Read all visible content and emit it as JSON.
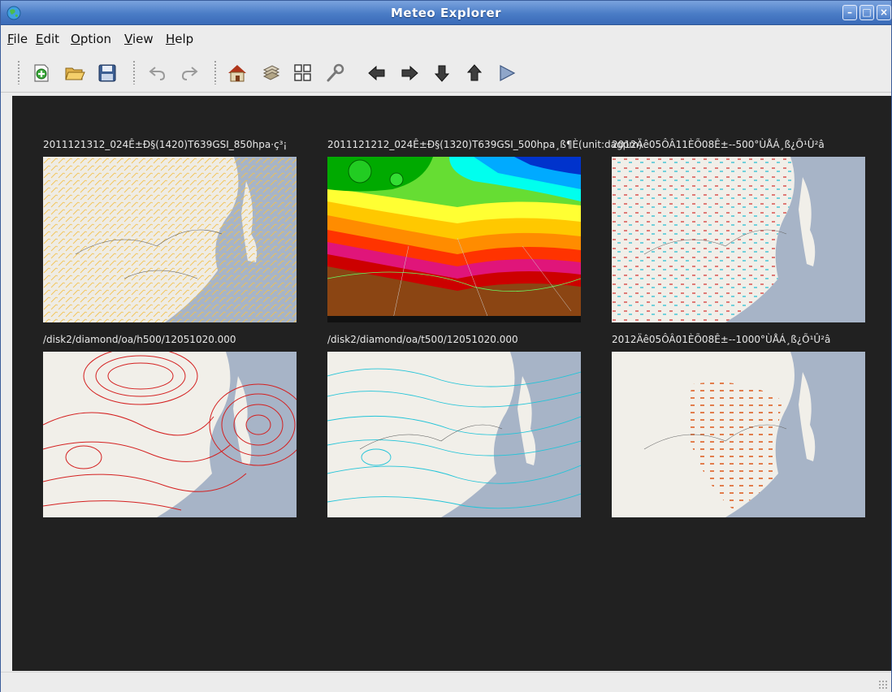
{
  "window": {
    "title": "Meteo Explorer"
  },
  "menu": [
    {
      "prefix": "",
      "mnemonic": "F",
      "rest": "ile"
    },
    {
      "prefix": "",
      "mnemonic": "E",
      "rest": "dit"
    },
    {
      "prefix": "",
      "mnemonic": "O",
      "rest": "ption"
    },
    {
      "prefix": "",
      "mnemonic": "V",
      "rest": "iew"
    },
    {
      "prefix": "",
      "mnemonic": "H",
      "rest": "elp"
    }
  ],
  "toolbar_icons": [
    "new-icon",
    "open-folder-icon",
    "save-icon",
    "undo-icon",
    "redo-icon",
    "home-icon",
    "layers-icon",
    "grid-icon",
    "wrench-icon",
    "arrow-left-icon",
    "arrow-right-icon",
    "arrow-down-icon",
    "arrow-up-icon",
    "play-icon"
  ],
  "panels": [
    {
      "caption": "2011121312_024Ê±Ð§(1420)T639GSI_850hpa·ç³¡",
      "map_type": "wind barbs",
      "accent": "#f2c14a"
    },
    {
      "caption": "2011121212_024Ê±Ð§(1320)T639GSI_500hpa¸ß¶È(unit:dagpm)",
      "map_type": "filled contours",
      "accent": "#8b4513"
    },
    {
      "caption": "2012Äê05ÔÂ11ÈÕ08Ê±--500°ÙÅÁ¸ß¿Õ¹Û²â",
      "map_type": "station plot",
      "accent": "#d9534f"
    },
    {
      "caption": "/disk2/diamond/oa/h500/12051020.000",
      "map_type": "red contours",
      "accent": "#d42020"
    },
    {
      "caption": "/disk2/diamond/oa/t500/12051020.000",
      "map_type": "cyan contours",
      "accent": "#22c4d8"
    },
    {
      "caption": "2012Äê05ÔÂ01ÈÕ08Ê±--1000°ÙÅÁ¸ß¿Õ¹Û²â",
      "map_type": "station plot",
      "accent": "#e0703a"
    }
  ],
  "colors": {
    "land": "#f1efe9",
    "sea": "#a7b4c7",
    "canvas": "#212121",
    "titlebar": "#4a7cc6"
  }
}
